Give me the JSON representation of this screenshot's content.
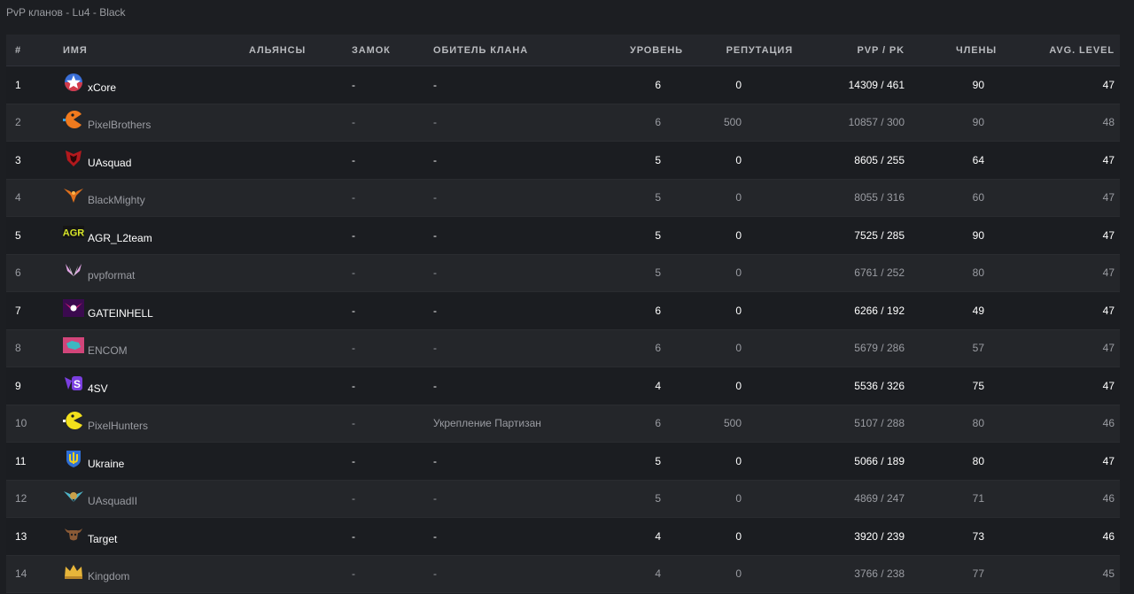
{
  "page_title": "PvP кланов - Lu4 - Black",
  "columns": {
    "rank": "#",
    "name": "ИМЯ",
    "alliance": "АЛЬЯНСЫ",
    "castle": "ЗАМОК",
    "clan_hall": "ОБИТЕЛЬ КЛАНА",
    "level": "УРОВЕНЬ",
    "reputation": "РЕПУТАЦИЯ",
    "pvp_pk": "PVP / PK",
    "members": "ЧЛЕНЫ",
    "avg_level": "AVG. LEVEL"
  },
  "rows": [
    {
      "rank": "1",
      "name": "xCore",
      "crest": "star-shield-icon",
      "crest_color": "#3a6fd8",
      "alliance": "",
      "castle": "-",
      "hall": "-",
      "level": "6",
      "reputation": "0",
      "pvp_pk": "14309 / 461",
      "members": "90",
      "avg_level": "47"
    },
    {
      "rank": "2",
      "name": "PixelBrothers",
      "crest": "pacman-orange-icon",
      "crest_color": "#f07a1e",
      "alliance": "",
      "castle": "-",
      "hall": "-",
      "level": "6",
      "reputation": "500",
      "pvp_pk": "10857 / 300",
      "members": "90",
      "avg_level": "48"
    },
    {
      "rank": "3",
      "name": "UAsquad",
      "crest": "red-emblem-icon",
      "crest_color": "#b3191d",
      "alliance": "",
      "castle": "-",
      "hall": "-",
      "level": "5",
      "reputation": "0",
      "pvp_pk": "8605 / 255",
      "members": "64",
      "avg_level": "47"
    },
    {
      "rank": "4",
      "name": "BlackMighty",
      "crest": "phoenix-icon",
      "crest_color": "#e0701d",
      "alliance": "",
      "castle": "-",
      "hall": "-",
      "level": "5",
      "reputation": "0",
      "pvp_pk": "8055 / 316",
      "members": "60",
      "avg_level": "47"
    },
    {
      "rank": "5",
      "name": "AGR_L2team",
      "crest": "agr-text-icon",
      "crest_color": "#d9e82a",
      "alliance": "",
      "castle": "-",
      "hall": "-",
      "level": "5",
      "reputation": "0",
      "pvp_pk": "7525 / 285",
      "members": "90",
      "avg_level": "47"
    },
    {
      "rank": "6",
      "name": "pvpformat",
      "crest": "wings-pink-icon",
      "crest_color": "#e3a6e6",
      "alliance": "",
      "castle": "-",
      "hall": "-",
      "level": "5",
      "reputation": "0",
      "pvp_pk": "6761 / 252",
      "members": "80",
      "avg_level": "47"
    },
    {
      "rank": "7",
      "name": "GATEINHELL",
      "crest": "winged-skull-icon",
      "crest_color": "#d21d78",
      "alliance": "",
      "castle": "-",
      "hall": "-",
      "level": "6",
      "reputation": "0",
      "pvp_pk": "6266 / 192",
      "members": "49",
      "avg_level": "47"
    },
    {
      "rank": "8",
      "name": "ENCOM",
      "crest": "pink-box-icon",
      "crest_color": "#d2457a",
      "alliance": "",
      "castle": "-",
      "hall": "-",
      "level": "6",
      "reputation": "0",
      "pvp_pk": "5679 / 286",
      "members": "57",
      "avg_level": "47"
    },
    {
      "rank": "9",
      "name": "4SV",
      "crest": "purple-s-icon",
      "crest_color": "#7b3fe0",
      "alliance": "",
      "castle": "-",
      "hall": "-",
      "level": "4",
      "reputation": "0",
      "pvp_pk": "5536 / 326",
      "members": "75",
      "avg_level": "47"
    },
    {
      "rank": "10",
      "name": "PixelHunters",
      "crest": "pacman-yellow-icon",
      "crest_color": "#f3e11c",
      "alliance": "",
      "castle": "-",
      "hall": "Укрепление Партизан",
      "level": "6",
      "reputation": "500",
      "pvp_pk": "5107 / 288",
      "members": "80",
      "avg_level": "46"
    },
    {
      "rank": "11",
      "name": "Ukraine",
      "crest": "trident-shield-icon",
      "crest_color": "#2f6fd6",
      "alliance": "",
      "castle": "-",
      "hall": "-",
      "level": "5",
      "reputation": "0",
      "pvp_pk": "5066 / 189",
      "members": "80",
      "avg_level": "47"
    },
    {
      "rank": "12",
      "name": "UAsquadII",
      "crest": "teal-wings-icon",
      "crest_color": "#4fb6c9",
      "alliance": "",
      "castle": "-",
      "hall": "-",
      "level": "5",
      "reputation": "0",
      "pvp_pk": "4869 / 247",
      "members": "71",
      "avg_level": "46"
    },
    {
      "rank": "13",
      "name": "Target",
      "crest": "bull-head-icon",
      "crest_color": "#8a5a36",
      "alliance": "",
      "castle": "-",
      "hall": "-",
      "level": "4",
      "reputation": "0",
      "pvp_pk": "3920 / 239",
      "members": "73",
      "avg_level": "46"
    },
    {
      "rank": "14",
      "name": "Kingdom",
      "crest": "crown-icon",
      "crest_color": "#e7b53a",
      "alliance": "",
      "castle": "-",
      "hall": "-",
      "level": "4",
      "reputation": "0",
      "pvp_pk": "3766 / 238",
      "members": "77",
      "avg_level": "45"
    }
  ]
}
